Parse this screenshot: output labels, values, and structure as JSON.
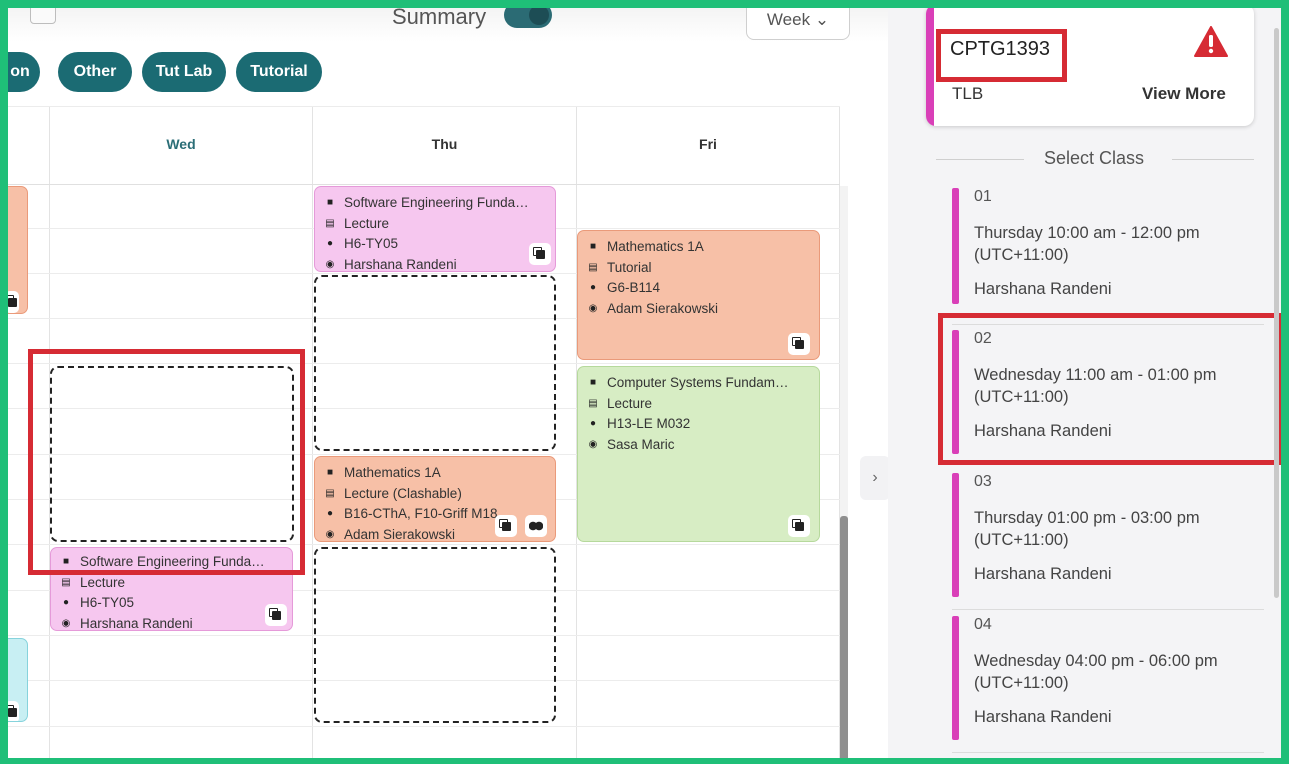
{
  "toolbar": {
    "summary_label": "Summary",
    "view_dropdown": "Week"
  },
  "filters": [
    "on",
    "Other",
    "Tut Lab",
    "Tutorial"
  ],
  "days": [
    "Wed",
    "Thu",
    "Fri"
  ],
  "events": {
    "thu_se": {
      "title": "Software Engineering Funda…",
      "type": "Lecture",
      "location": "H6-TY05",
      "person": "Harshana Randeni"
    },
    "fri_math": {
      "title": "Mathematics 1A",
      "type": "Tutorial",
      "location": "G6-B114",
      "person": "Adam Sierakowski"
    },
    "fri_cs": {
      "title": "Computer Systems Fundam…",
      "type": "Lecture",
      "location": "H13-LE M032",
      "person": "Sasa Maric"
    },
    "thu_math": {
      "title": "Mathematics 1A",
      "type": "Lecture (Clashable)",
      "location": "B16-CThA, F10-Griff M18",
      "person": "Adam Sierakowski"
    },
    "wed_se": {
      "title": "Software Engineering Funda…",
      "type": "Lecture",
      "location": "H6-TY05",
      "person": "Harshana Randeni"
    }
  },
  "panel": {
    "course_code": "CPTG1393",
    "course_type": "TLB",
    "view_more": "View More",
    "select_title": "Select Class",
    "classes": [
      {
        "num": "01",
        "time": "Thursday 10:00 am - 12:00 pm (UTC+11:00)",
        "tutor": "Harshana Randeni"
      },
      {
        "num": "02",
        "time": "Wednesday 11:00 am - 01:00 pm (UTC+11:00)",
        "tutor": "Harshana Randeni"
      },
      {
        "num": "03",
        "time": "Thursday 01:00 pm - 03:00 pm (UTC+11:00)",
        "tutor": "Harshana Randeni"
      },
      {
        "num": "04",
        "time": "Wednesday 04:00 pm - 06:00 pm (UTC+11:00)",
        "tutor": "Harshana Randeni"
      }
    ]
  },
  "colors": {
    "frame": "#1fbf78",
    "pill": "#1b6b73",
    "accent_bar": "#d93fb8",
    "highlight": "#d62b34",
    "event_pink": "#f6c7ef",
    "event_orange": "#f7c0a7",
    "event_green": "#d7edc4",
    "event_cyan": "#c8eff3",
    "warning": "#d62b34"
  }
}
